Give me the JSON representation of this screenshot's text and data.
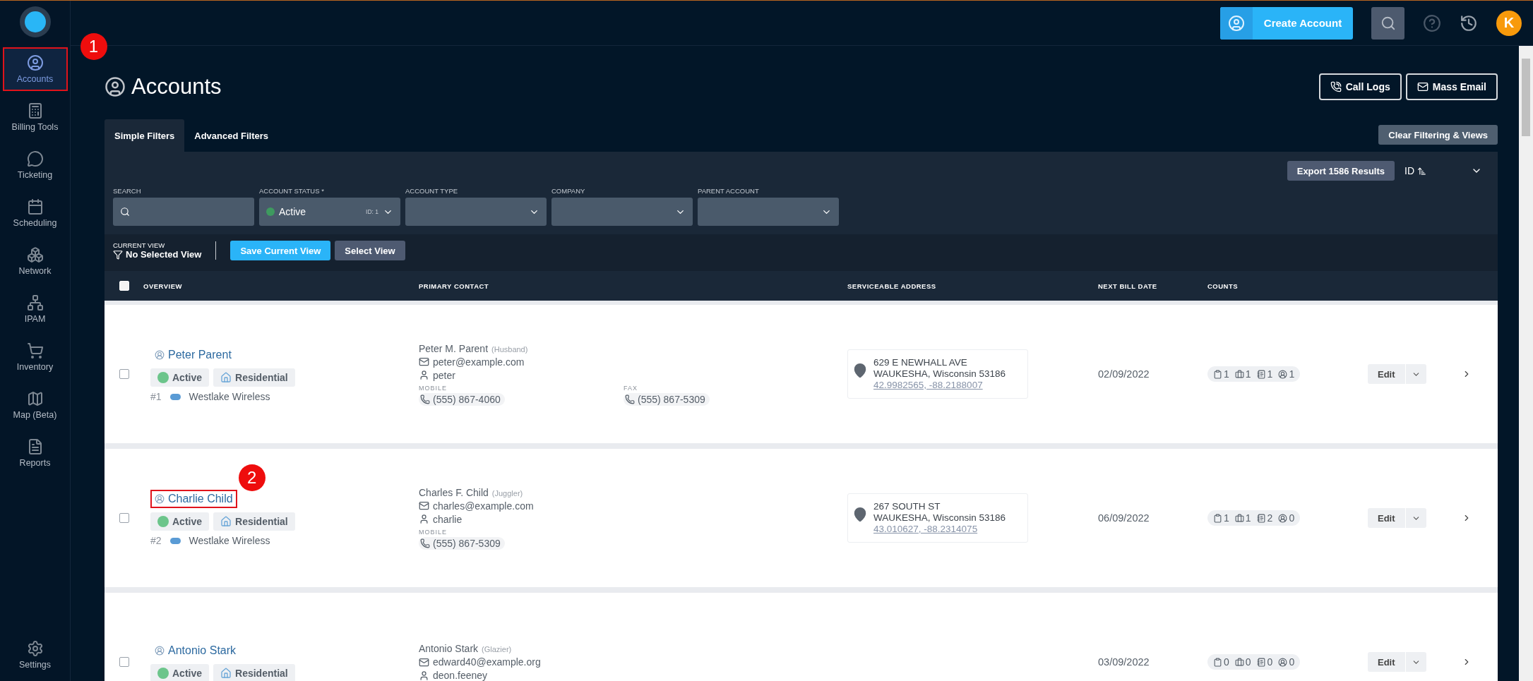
{
  "sidebar": {
    "items": [
      {
        "label": "Accounts",
        "selected": true,
        "callout": "1"
      },
      {
        "label": "Billing Tools",
        "selected": false
      },
      {
        "label": "Ticketing",
        "selected": false
      },
      {
        "label": "Scheduling",
        "selected": false
      },
      {
        "label": "Network",
        "selected": false
      },
      {
        "label": "IPAM",
        "selected": false
      },
      {
        "label": "Inventory",
        "selected": false
      },
      {
        "label": "Map (Beta)",
        "selected": false
      },
      {
        "label": "Reports",
        "selected": false
      }
    ],
    "footer": {
      "label": "Settings",
      "selected": false
    }
  },
  "topbar": {
    "create_button": "Create Account",
    "avatar": "K"
  },
  "header": {
    "title": "Accounts",
    "buttons": [
      "Call Logs",
      "Mass Email"
    ]
  },
  "filter_tabs": [
    {
      "label": "Simple Filters",
      "selected": true
    },
    {
      "label": "Advanced Filters",
      "selected": false
    }
  ],
  "clear_button": "Clear Filtering & Views",
  "export_button": "Export 1586 Results",
  "sort": {
    "label": "ID"
  },
  "filters": [
    {
      "label": "SEARCH",
      "kind": "search"
    },
    {
      "label": "ACCOUNT STATUS *",
      "kind": "select",
      "value": "Active",
      "tag": "ID: 1"
    },
    {
      "label": "ACCOUNT TYPE",
      "kind": "select"
    },
    {
      "label": "COMPANY",
      "kind": "select"
    },
    {
      "label": "PARENT ACCOUNT",
      "kind": "select"
    }
  ],
  "current_view": {
    "label": "CURRENT VIEW",
    "value": "No Selected View",
    "buttons": [
      {
        "label": "Save Current View",
        "kind": "primary"
      },
      {
        "label": "Select View",
        "kind": "secondary"
      }
    ]
  },
  "table": {
    "checked": false,
    "columns": [
      "OVERVIEW",
      "PRIMARY CONTACT",
      "SERVICEABLE ADDRESS",
      "NEXT BILL DATE",
      "COUNTS"
    ],
    "rows": [
      {
        "checked": false,
        "name": "Peter Parent",
        "status": "Active",
        "type": "Residential",
        "number": "#1",
        "company": "Westlake Wireless",
        "contact": {
          "name": "Peter M. Parent",
          "role": "(Husband)",
          "email": "peter@example.com",
          "username": "peter",
          "phones": [
            {
              "label": "MOBILE",
              "number": "(555) 867-4060"
            },
            {
              "label": "FAX",
              "number": "(555) 867-5309"
            }
          ]
        },
        "address": {
          "line1": "629 E NEWHALL AVE",
          "line2": "WAUKESHA, Wisconsin 53186",
          "coords": "42.9982565, -88.2188007"
        },
        "bill_date": "02/09/2022",
        "counts": [
          "1",
          "1",
          "1",
          "1"
        ],
        "edit": "Edit"
      },
      {
        "checked": false,
        "name": "Charlie Child",
        "callout": "2",
        "status": "Active",
        "type": "Residential",
        "number": "#2",
        "company": "Westlake Wireless",
        "contact": {
          "name": "Charles F. Child",
          "role": "(Juggler)",
          "email": "charles@example.com",
          "username": "charlie",
          "phones": [
            {
              "label": "MOBILE",
              "number": "(555) 867-5309"
            }
          ]
        },
        "address": {
          "line1": "267 SOUTH ST",
          "line2": "WAUKESHA, Wisconsin 53186",
          "coords": "43.010627, -88.2314075"
        },
        "bill_date": "06/09/2022",
        "counts": [
          "1",
          "1",
          "2",
          "0"
        ],
        "edit": "Edit"
      },
      {
        "checked": false,
        "name": "Antonio Stark",
        "status": "Active",
        "type": "Residential",
        "contact": {
          "name": "Antonio Stark",
          "role": "(Glazier)",
          "email": "edward40@example.org",
          "username": "deon.feeney"
        },
        "bill_date": "03/09/2022",
        "counts": [
          "0",
          "0",
          "0",
          "0"
        ],
        "edit": "Edit"
      }
    ]
  }
}
